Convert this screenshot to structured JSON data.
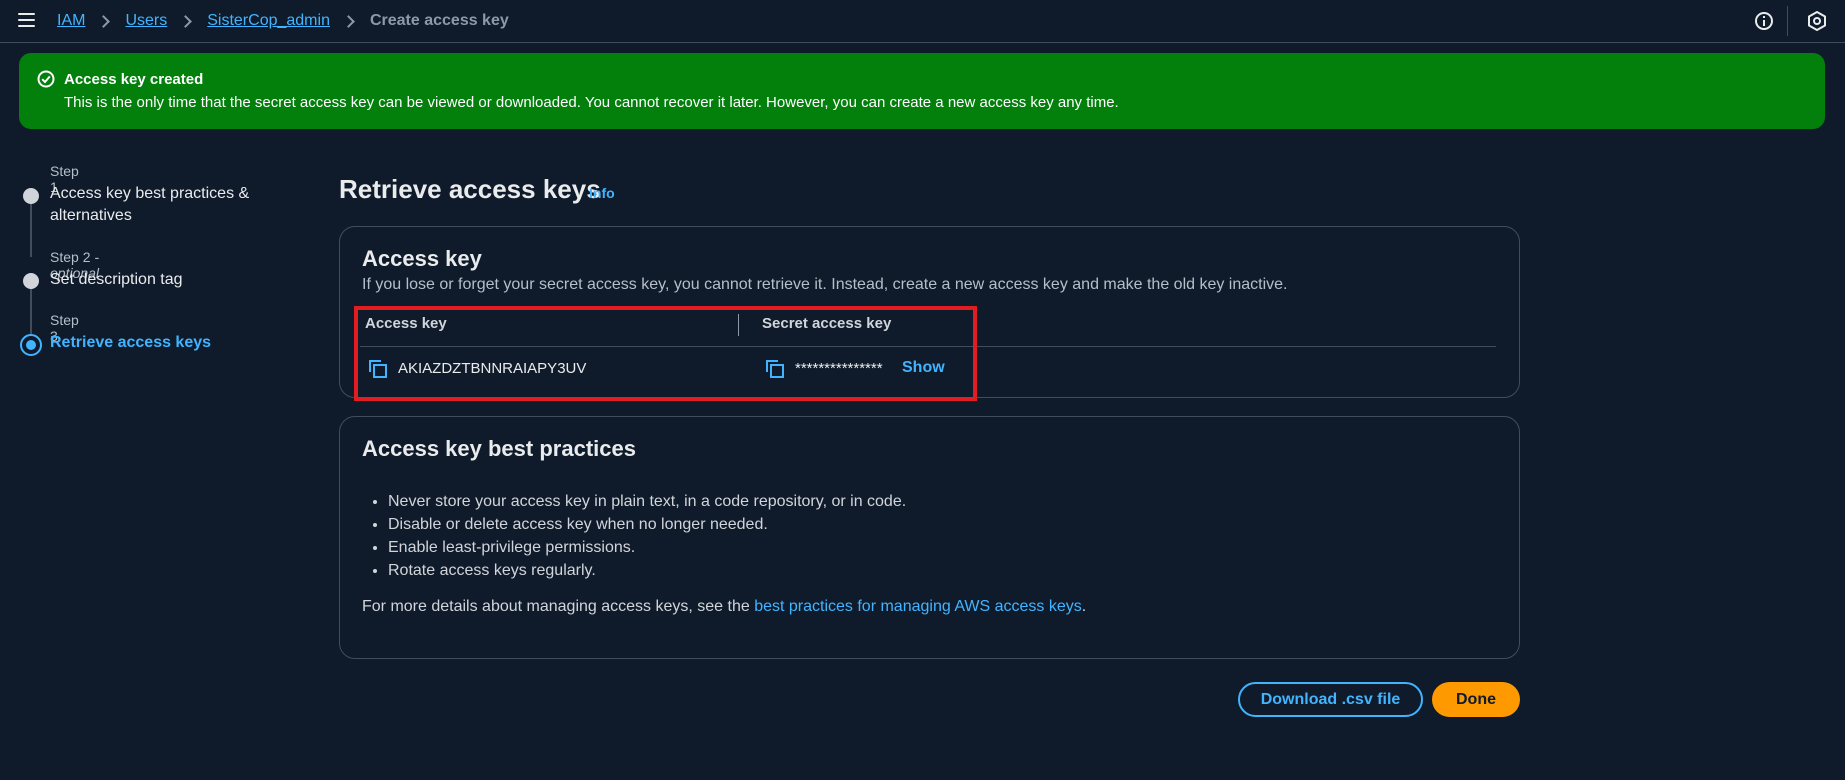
{
  "breadcrumb": {
    "items": [
      "IAM",
      "Users",
      "SisterCop_admin"
    ],
    "current": "Create access key"
  },
  "flash": {
    "title": "Access key created",
    "message": "This is the only time that the secret access key can be viewed or downloaded. You cannot recover it later. However, you can create a new access key any time.",
    "color": "#037f0c"
  },
  "steps": [
    {
      "label": "Step 1",
      "label_suffix": "",
      "title": "Access key best practices & alternatives",
      "state": "complete"
    },
    {
      "label": "Step 2",
      "label_suffix": " - optional",
      "title": "Set description tag",
      "state": "complete"
    },
    {
      "label": "Step 3",
      "label_suffix": "",
      "title": "Retrieve access keys",
      "state": "active"
    }
  ],
  "page": {
    "title": "Retrieve access keys",
    "info_link": "Info"
  },
  "access_key_panel": {
    "title": "Access key",
    "description": "If you lose or forget your secret access key, you cannot retrieve it. Instead, create a new access key and make the old key inactive.",
    "columns": [
      "Access key",
      "Secret access key"
    ],
    "access_key_value": "AKIAZDZTBNNRAIAPY3UV",
    "secret_value": "***************",
    "show_label": "Show"
  },
  "best_practices": {
    "title": "Access key best practices",
    "items": [
      "Never store your access key in plain text, in a code repository, or in code.",
      "Disable or delete access key when no longer needed.",
      "Enable least-privilege permissions.",
      "Rotate access keys regularly."
    ],
    "footer_prefix": "For more details about managing access keys, see the ",
    "footer_link": "best practices for managing AWS access keys",
    "footer_suffix": "."
  },
  "actions": {
    "download_label": "Download .csv file",
    "done_label": "Done"
  },
  "colors": {
    "background": "#0f1b2a",
    "link": "#42b4ff",
    "primary_button": "#ff9900",
    "highlight": "#e11d21"
  }
}
